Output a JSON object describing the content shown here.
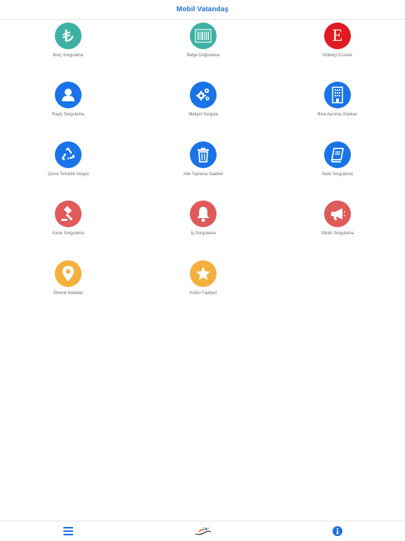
{
  "header": {
    "title": "Mobil Vatandaş"
  },
  "colors": {
    "accent": "#1f6fe0",
    "teal": "#3cb1a4",
    "red_e": "#e01b22",
    "blue": "#1a73e8",
    "red": "#e05a59",
    "amber": "#f4b03e"
  },
  "tiles": [
    {
      "label": "Borç Sorgulama",
      "icon": "lira-icon",
      "color": "#3cb1a4"
    },
    {
      "label": "Belge Doğrulama",
      "icon": "barcode-icon",
      "color": "#3cb1a4"
    },
    {
      "label": "Nöbetçi Eczane",
      "icon": "pharmacy-e-icon",
      "color": "#e01b22",
      "glyph": "E"
    },
    {
      "label": "Rayiç Sorgulama",
      "icon": "user-icon",
      "color": "#1a73e8"
    },
    {
      "label": "Maliyet Sorgula",
      "icon": "gears-icon",
      "color": "#1a73e8"
    },
    {
      "label": "Bina Aşınma Oranları",
      "icon": "building-icon",
      "color": "#1a73e8"
    },
    {
      "label": "Çevre Temizlik Vergisi",
      "icon": "recycle-icon",
      "color": "#1a73e8"
    },
    {
      "label": "Atık Toplama Saatleri",
      "icon": "trash-icon",
      "color": "#1a73e8"
    },
    {
      "label": "İhale Sorgulama",
      "icon": "book-icon",
      "color": "#1a73e8"
    },
    {
      "label": "Karar Sorgulama",
      "icon": "gavel-icon",
      "color": "#e05a59"
    },
    {
      "label": "İş Sorgulama",
      "icon": "bell-icon",
      "color": "#e05a59"
    },
    {
      "label": "Nikah Sorgulama",
      "icon": "megaphone-icon",
      "color": "#e05a59"
    },
    {
      "label": "Önemli Noktalar",
      "icon": "map-pin-icon",
      "color": "#f4b03e"
    },
    {
      "label": "Kültür Faaliyet",
      "icon": "star-icon",
      "color": "#f4b03e"
    }
  ],
  "tabbar": {
    "items": [
      {
        "icon": "menu-icon"
      },
      {
        "icon": "logo-icon"
      },
      {
        "icon": "info-icon"
      }
    ]
  }
}
